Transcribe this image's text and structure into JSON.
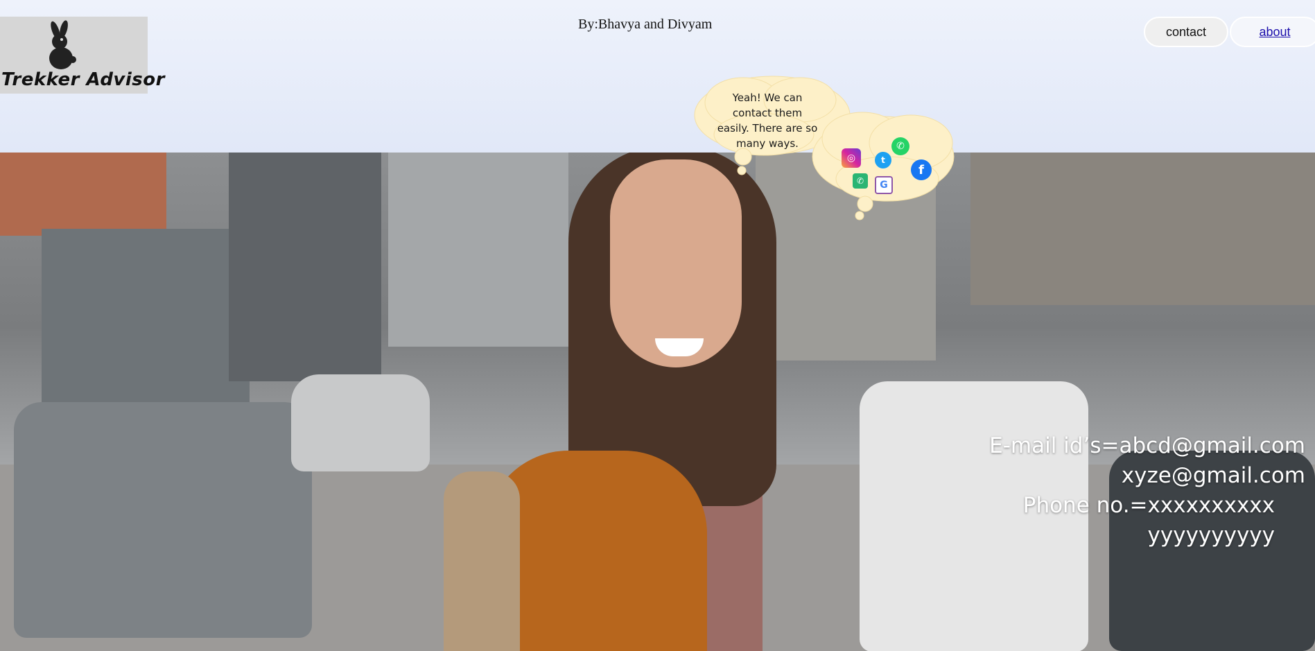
{
  "header": {
    "logo_text": "Trekker Advisor",
    "byline": "By:Bhavya and Divyam"
  },
  "nav": {
    "contact_label": "contact",
    "about_label": "about"
  },
  "bubble": {
    "text": "Yeah! We can contact them easily. There are so many ways.",
    "icons": [
      "instagram-icon",
      "twitter-icon",
      "whatsapp-icon",
      "facebook-icon",
      "phone-icon",
      "google-icon"
    ]
  },
  "hero": {
    "email_line_1": "E-mail id’s=abcd@gmail.com",
    "email_line_2": "xyze@gmail.com",
    "phone_line_1": "Phone no.=xxxxxxxxxx",
    "phone_line_2": "yyyyyyyyyy"
  },
  "colors": {
    "accent_link": "#1a0dab",
    "bubble_fill": "#fdf0c8",
    "text_light": "#ffffff"
  }
}
